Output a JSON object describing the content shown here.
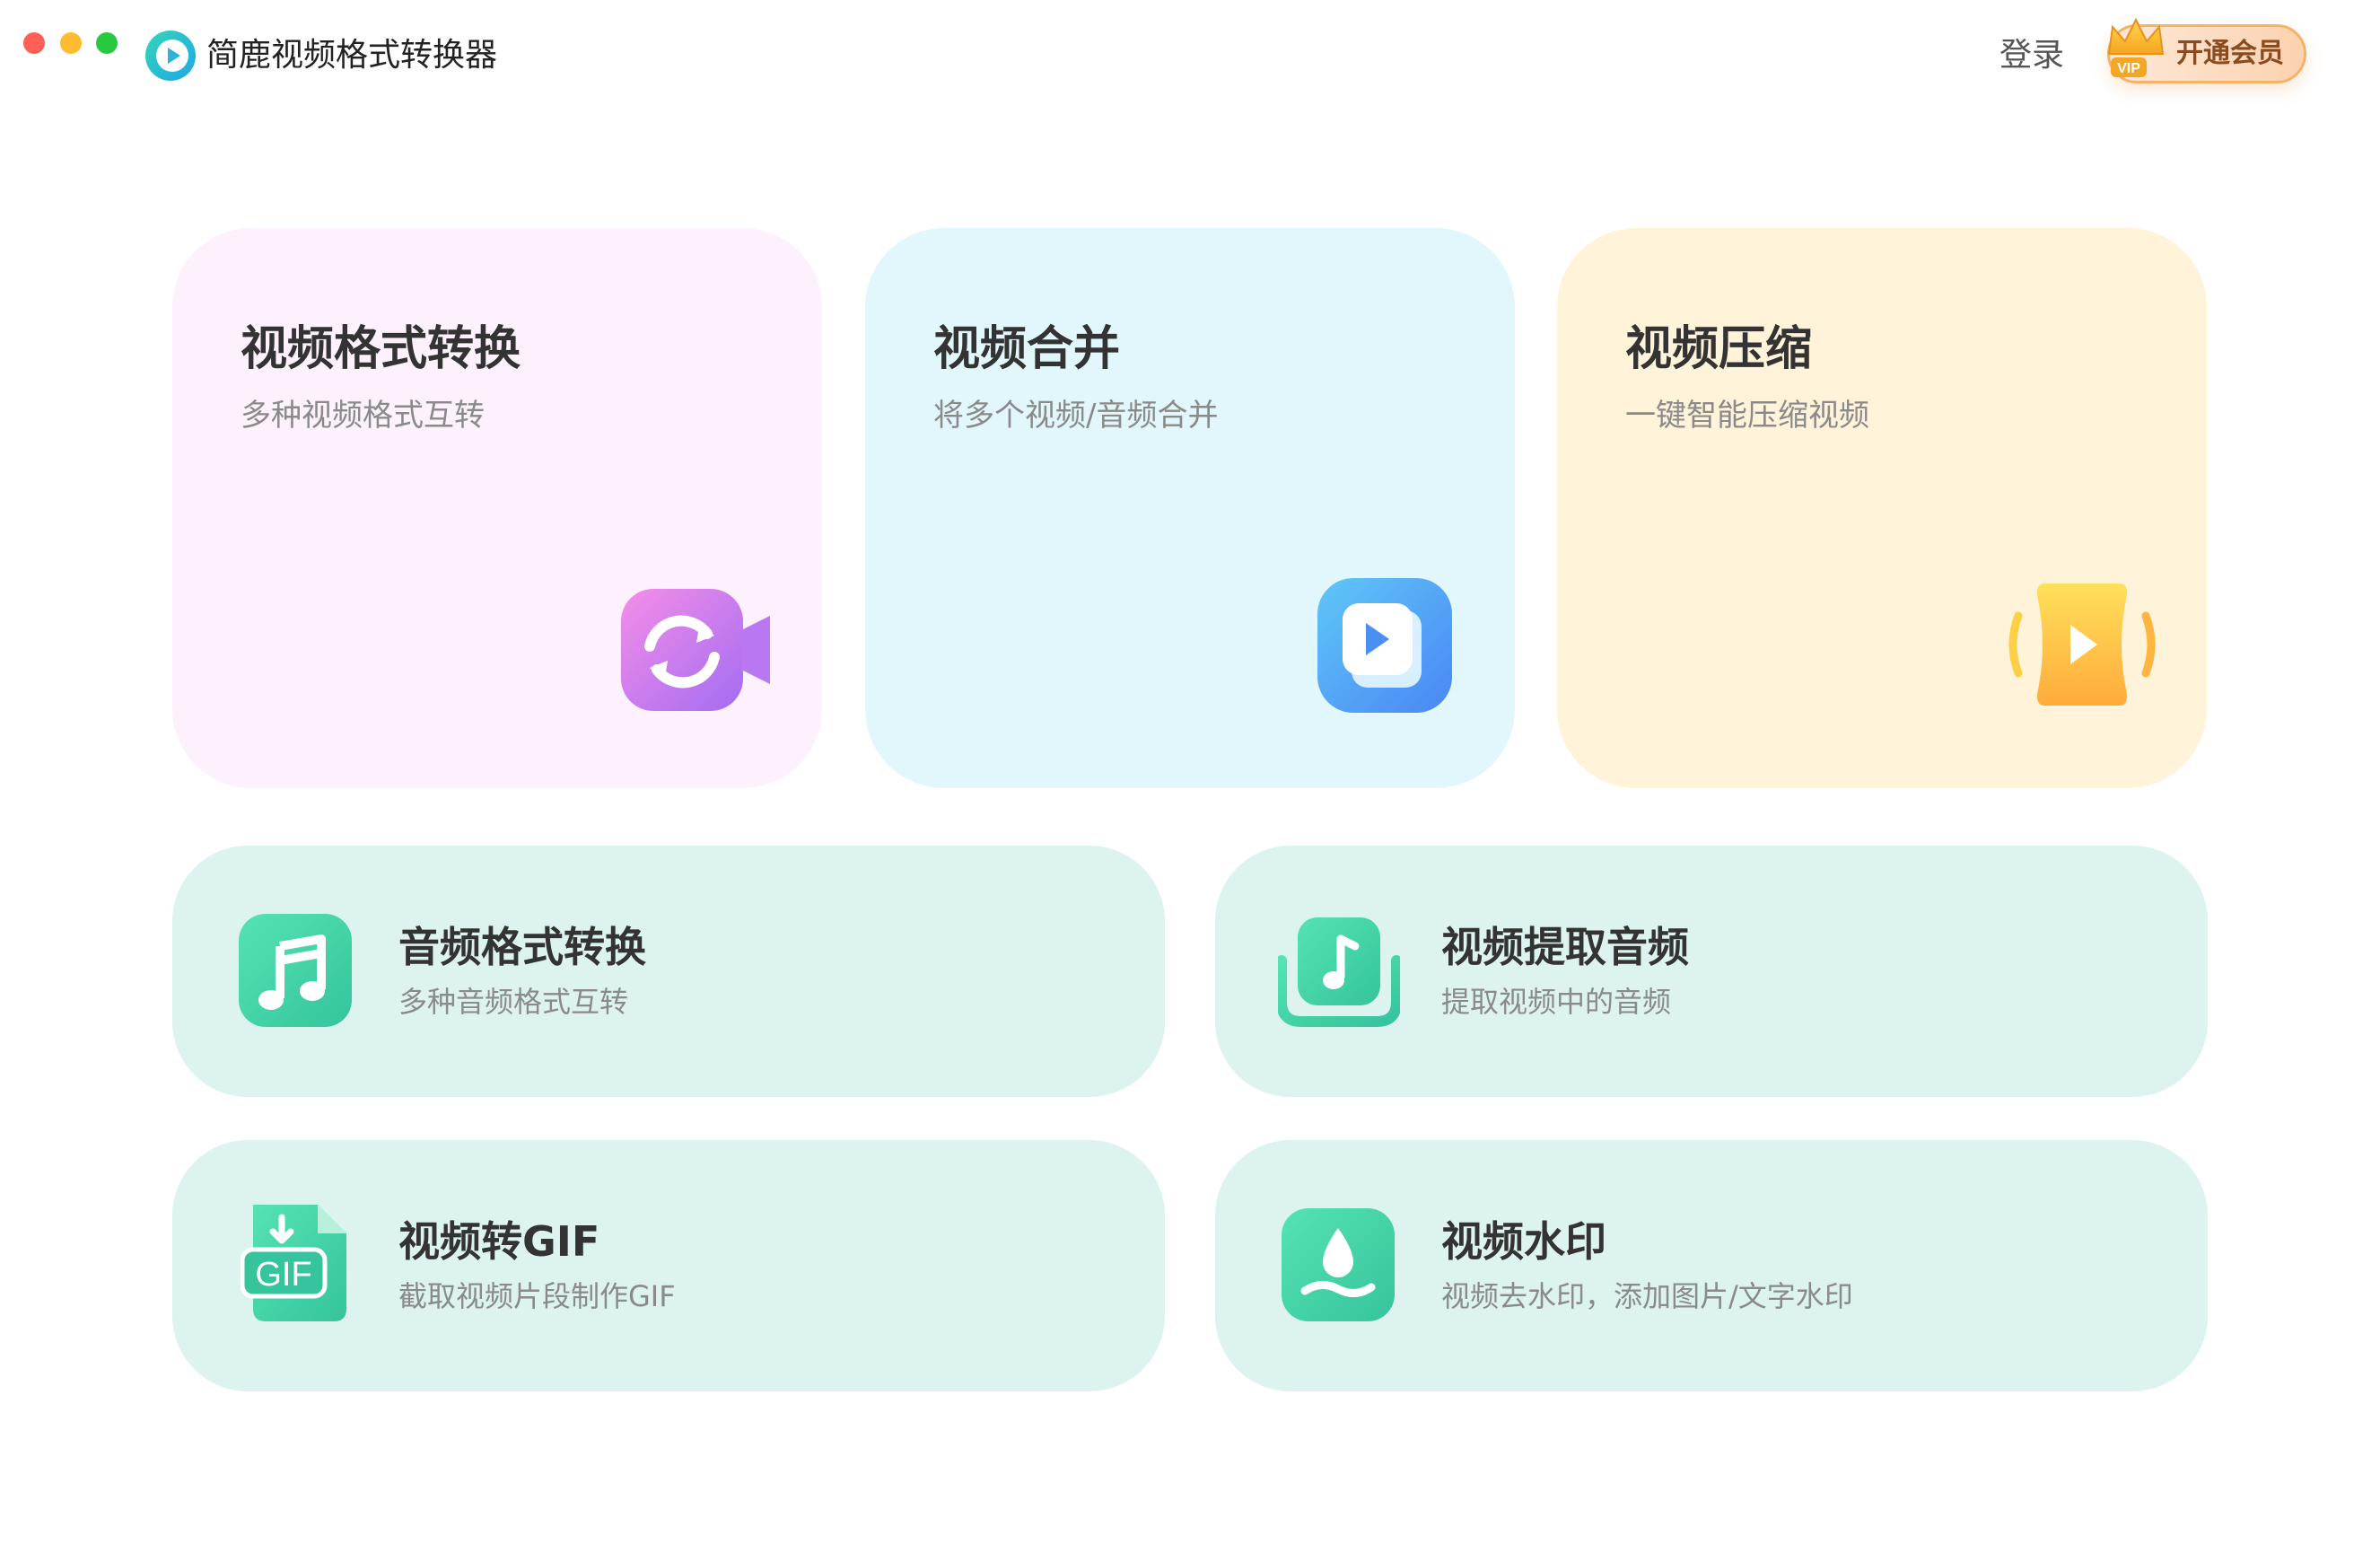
{
  "window": {
    "controls": [
      "close",
      "minimize",
      "zoom"
    ]
  },
  "header": {
    "app_title": "简鹿视频格式转换器",
    "login_label": "登录",
    "vip_label": "开通会员",
    "vip_badge": "VIP"
  },
  "feature_cards": [
    {
      "title": "视频格式转换",
      "subtitle": "多种视频格式互转",
      "icon": "video-convert-icon"
    },
    {
      "title": "视频合并",
      "subtitle": "将多个视频/音频合并",
      "icon": "video-merge-icon"
    },
    {
      "title": "视频压缩",
      "subtitle": "一键智能压缩视频",
      "icon": "video-compress-icon"
    }
  ],
  "tool_cards": [
    {
      "title": "音频格式转换",
      "subtitle": "多种音频格式互转",
      "icon": "music-note-icon"
    },
    {
      "title": "视频提取音频",
      "subtitle": "提取视频中的音频",
      "icon": "audio-extract-icon"
    },
    {
      "title": "视频转GIF",
      "subtitle": "截取视频片段制作GIF",
      "icon": "gif-file-icon",
      "icon_text": "GIF"
    },
    {
      "title": "视频水印",
      "subtitle": "视频去水印，添加图片/文字水印",
      "icon": "watermark-drop-icon"
    }
  ],
  "colors": {
    "convert_card": "#fcf1fc",
    "merge_card": "#e1f7fb",
    "compress_card": "#fff3d9",
    "tool_card": "#dcf3ef",
    "accent_green": "#3fd0a6"
  }
}
